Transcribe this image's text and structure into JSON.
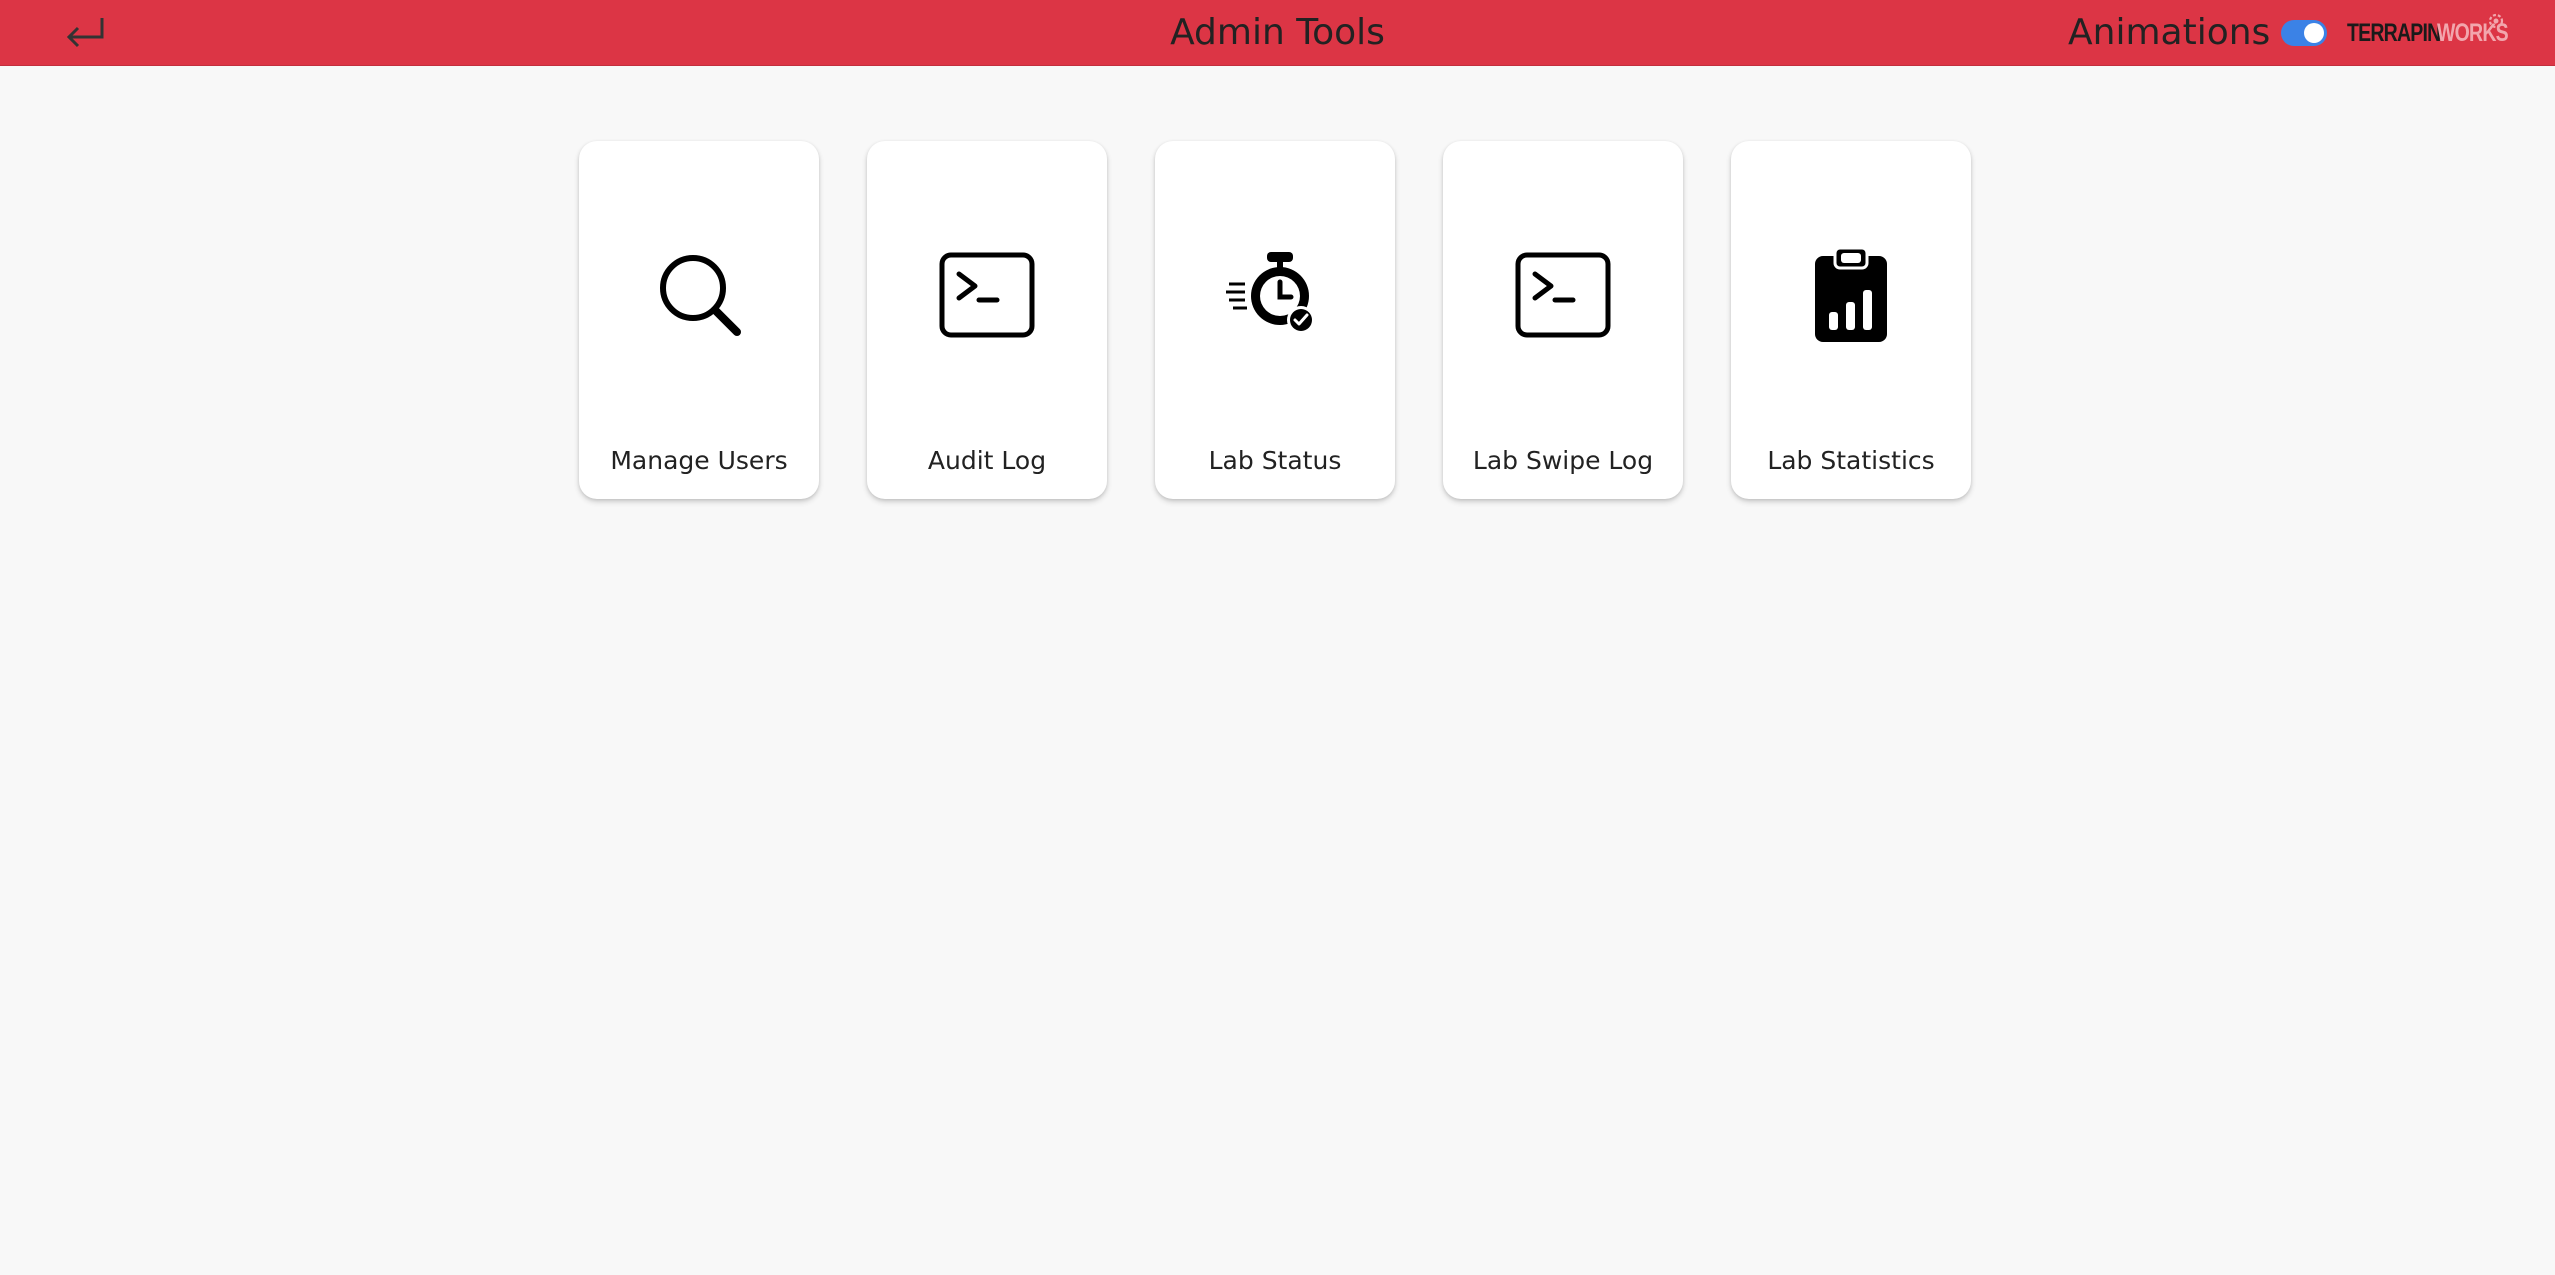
{
  "header": {
    "title": "Admin Tools",
    "back_icon": "return-arrow-icon",
    "animations_label": "Animations",
    "animations_enabled": true,
    "logo_part1": "TERRAPIN",
    "logo_part2": "WORKS",
    "colors": {
      "bar": "#dc3545",
      "toggle_on": "#3b82e6"
    }
  },
  "cards": [
    {
      "label": "Manage Users",
      "icon": "search-icon"
    },
    {
      "label": "Audit Log",
      "icon": "terminal-icon"
    },
    {
      "label": "Lab Status",
      "icon": "stopwatch-check-icon"
    },
    {
      "label": "Lab Swipe Log",
      "icon": "terminal-icon"
    },
    {
      "label": "Lab Statistics",
      "icon": "clipboard-chart-icon"
    }
  ]
}
